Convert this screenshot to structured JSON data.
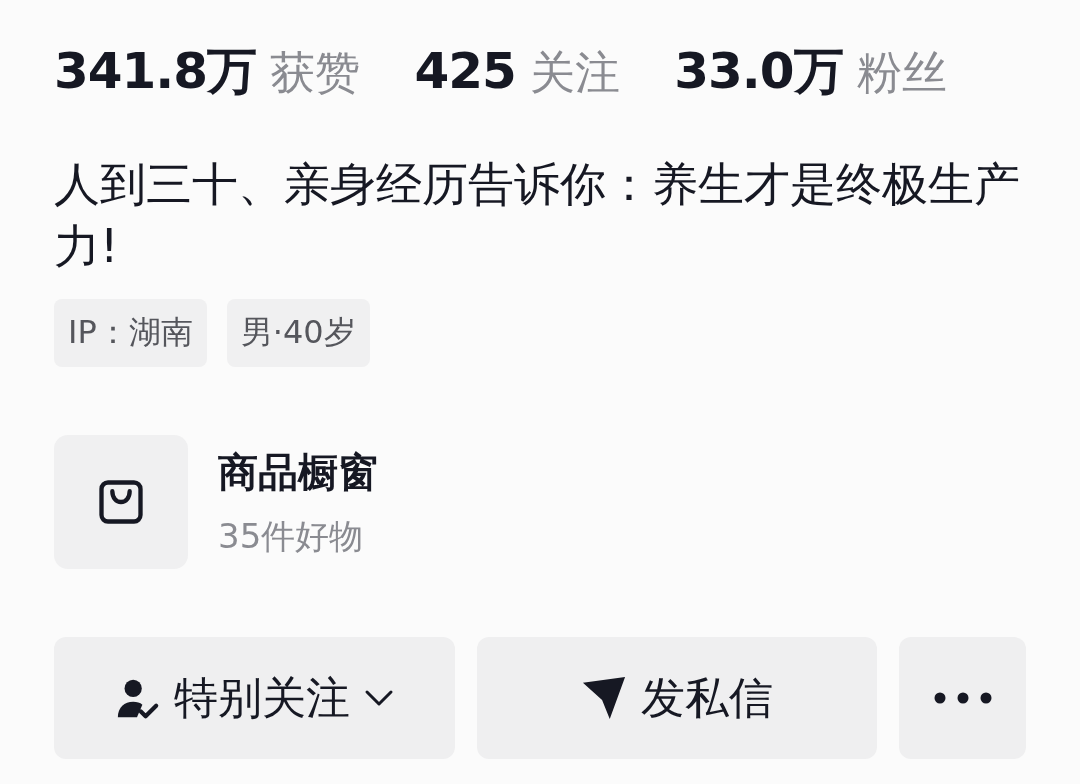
{
  "stats": [
    "**341.8万** 获赞",
    "**425** 关注",
    "**33.0万** 粉丝"
  ],
  "bio": "人到三十、亲身经历告诉你：养生才是终极生产力!",
  "tags": [
    "IP：湖南",
    "男·40岁"
  ],
  "shop": {
    "title": "商品橱窗",
    "subtitle": "35件好物"
  },
  "buttons": [
    {
      "kind": "follow",
      "label": "特别关注"
    },
    {
      "kind": "message",
      "label": "发私信"
    },
    {
      "kind": "more"
    }
  ]
}
